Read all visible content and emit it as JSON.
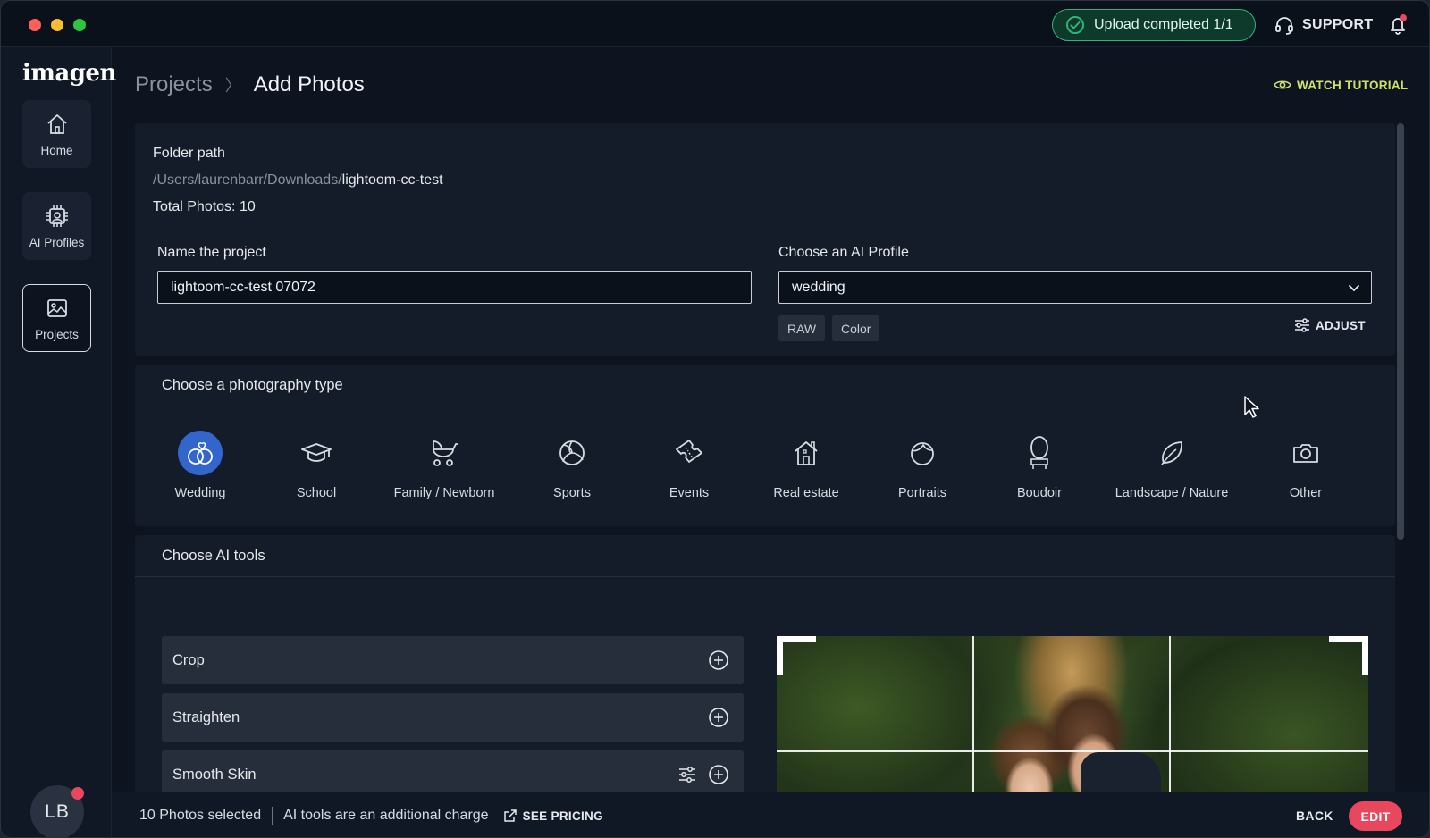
{
  "titlebar": {
    "upload_status": "Upload completed 1/1",
    "support_label": "SUPPORT",
    "status_color": "#2fb37a"
  },
  "sidebar": {
    "logo": "imagen",
    "items": [
      {
        "label": "Home",
        "icon": "home-icon"
      },
      {
        "label": "AI Profiles",
        "icon": "chip-icon"
      },
      {
        "label": "Projects",
        "icon": "image-icon",
        "active": true
      }
    ],
    "avatar_initials": "LB"
  },
  "header": {
    "breadcrumb_parent": "Projects",
    "breadcrumb_separator": "〉",
    "breadcrumb_current": "Add Photos",
    "watch_tutorial": "WATCH TUTORIAL",
    "accent_color": "#cfe36a"
  },
  "folder": {
    "label": "Folder path",
    "path_prefix": "/Users/laurenbarr/Downloads/",
    "path_folder": "lightoom-cc-test",
    "total": "Total Photos: 10"
  },
  "project": {
    "name_label": "Name the project",
    "name_value": "lightoom-cc-test 07072",
    "profile_label": "Choose an AI Profile",
    "profile_value": "wedding",
    "chips": [
      "RAW",
      "Color"
    ],
    "adjust_label": "ADJUST"
  },
  "photography": {
    "title": "Choose a photography type",
    "selected_color": "#3366cc",
    "types": [
      {
        "label": "Wedding",
        "icon": "rings-icon",
        "selected": true
      },
      {
        "label": "School",
        "icon": "graduation-cap-icon"
      },
      {
        "label": "Family / Newborn",
        "icon": "stroller-icon"
      },
      {
        "label": "Sports",
        "icon": "volleyball-icon"
      },
      {
        "label": "Events",
        "icon": "ticket-icon"
      },
      {
        "label": "Real estate",
        "icon": "house-icon"
      },
      {
        "label": "Portraits",
        "icon": "face-icon"
      },
      {
        "label": "Boudoir",
        "icon": "mirror-icon"
      },
      {
        "label": "Landscape / Nature",
        "icon": "leaf-icon"
      },
      {
        "label": "Other",
        "icon": "camera-icon"
      }
    ]
  },
  "ai_tools": {
    "title": "Choose AI tools",
    "tools": [
      {
        "label": "Crop",
        "has_settings": false
      },
      {
        "label": "Straighten",
        "has_settings": false
      },
      {
        "label": "Smooth Skin",
        "has_settings": true
      }
    ]
  },
  "footer": {
    "selected": "10 Photos selected",
    "charge": "AI tools are an additional charge",
    "pricing": "SEE PRICING",
    "back": "BACK",
    "edit": "EDIT",
    "edit_color": "#e8475e"
  }
}
